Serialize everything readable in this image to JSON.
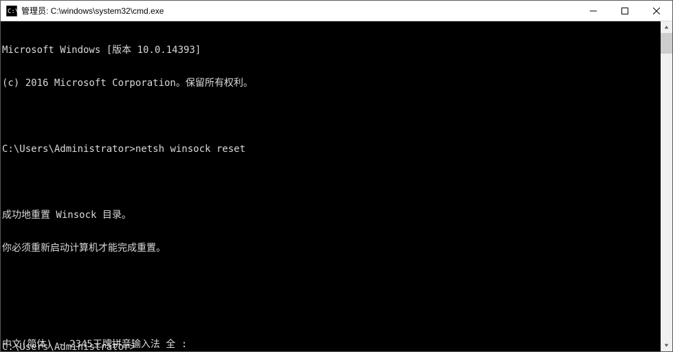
{
  "titlebar": {
    "title": "管理员: C:\\windows\\system32\\cmd.exe"
  },
  "console": {
    "line1": "Microsoft Windows [版本 10.0.14393]",
    "line2": "(c) 2016 Microsoft Corporation。保留所有权利。",
    "blank1": "",
    "prompt1_path": "C:\\Users\\Administrator>",
    "prompt1_cmd": "netsh winsock reset",
    "blank2": "",
    "result1": "成功地重置 Winsock 目录。",
    "result2": "你必须重新启动计算机才能完成重置。",
    "blank3": "",
    "blank4": "",
    "prompt2_path": "C:\\Users\\Administrator>",
    "ime_status": "中文(简体) - 2345王牌拼音输入法 全 :"
  }
}
